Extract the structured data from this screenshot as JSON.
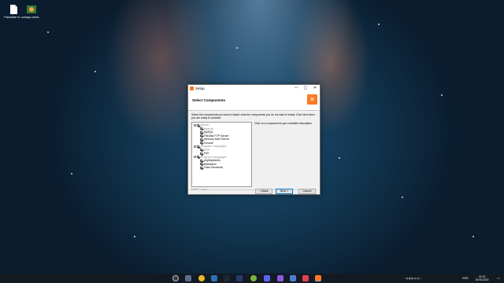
{
  "desktop": {
    "icons": [
      {
        "label": "Paradise m...",
        "icon": "document-icon"
      },
      {
        "label": "xampp-wind...",
        "icon": "installer-icon"
      }
    ]
  },
  "window": {
    "title": "Setup",
    "controls": [
      "—",
      "□",
      "✕"
    ],
    "header_title": "Select Components",
    "instructions": "Select the components you want to install; clear the components you do not want to install. Click Next when you are ready to continue.",
    "description": "Click on a component to get a detailed description.",
    "components": [
      {
        "label": "Server",
        "level": 0,
        "checked": true,
        "dim": true,
        "expander": "−"
      },
      {
        "label": "Apache",
        "level": 1,
        "checked": true,
        "dim": true
      },
      {
        "label": "MySQL",
        "level": 1,
        "checked": true,
        "dim": false
      },
      {
        "label": "FileZilla FTP Server",
        "level": 1,
        "checked": true,
        "dim": false
      },
      {
        "label": "Mercury Mail Server",
        "level": 1,
        "checked": true,
        "dim": false
      },
      {
        "label": "Tomcat",
        "level": 1,
        "checked": true,
        "dim": false
      },
      {
        "label": "Program Languages",
        "level": 0,
        "checked": true,
        "dim": true,
        "expander": "−"
      },
      {
        "label": "PHP",
        "level": 1,
        "checked": true,
        "dim": true
      },
      {
        "label": "Perl",
        "level": 1,
        "checked": true,
        "dim": false
      },
      {
        "label": "Program Languages",
        "level": 0,
        "checked": true,
        "dim": true,
        "expander": "−"
      },
      {
        "label": "phpMyAdmin",
        "level": 1,
        "checked": true,
        "dim": false
      },
      {
        "label": "Webalizer",
        "level": 1,
        "checked": true,
        "dim": false
      },
      {
        "label": "Fake Sendmail",
        "level": 1,
        "checked": true,
        "dim": false
      }
    ],
    "footer_label": "XAMPP Installer",
    "buttons": {
      "back": "< Back",
      "next": "Next >",
      "cancel": "Cancel"
    }
  },
  "taskbar": {
    "language": "ENG",
    "time": "14:13",
    "date": "15.05.2022"
  }
}
